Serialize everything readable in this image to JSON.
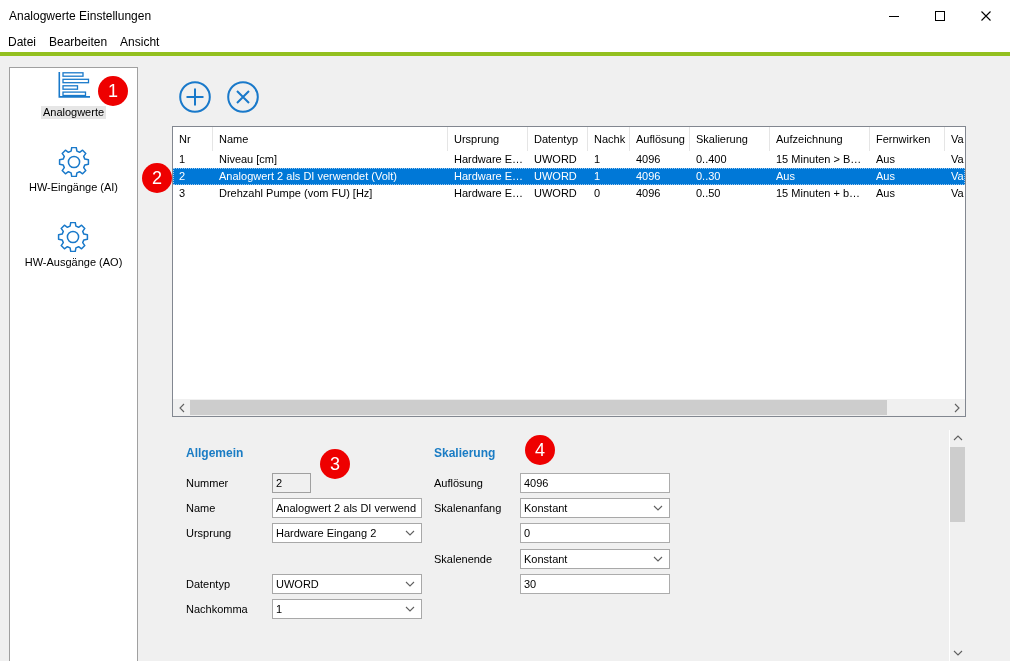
{
  "window": {
    "title": "Analogwerte Einstellungen"
  },
  "menu": [
    {
      "label": "Datei"
    },
    {
      "label": "Bearbeiten"
    },
    {
      "label": "Ansicht"
    }
  ],
  "sidebar": {
    "items": [
      {
        "label": "Analogwerte",
        "kind": "bars",
        "selected": true
      },
      {
        "label": "HW-Eingänge (AI)",
        "kind": "gear",
        "selected": false
      },
      {
        "label": "HW-Ausgänge (AO)",
        "kind": "gear",
        "selected": false
      }
    ]
  },
  "toolbar": [
    {
      "kind": "add"
    },
    {
      "kind": "remove"
    }
  ],
  "table": {
    "columns": [
      "Nr",
      "Name",
      "Ursprung",
      "Datentyp",
      "Nachk",
      "Auflösung",
      "Skalierung",
      "Aufzeichnung",
      "Fernwirken",
      "Va"
    ],
    "rows": [
      {
        "selected": false,
        "cells": [
          "1",
          "Niveau [cm]",
          "Hardware E…",
          "UWORD",
          "1",
          "4096",
          "0..400",
          "15 Minuten > B…",
          "Aus",
          "Va"
        ]
      },
      {
        "selected": true,
        "cells": [
          "2",
          "Analogwert 2 als DI verwendet (Volt)",
          "Hardware E…",
          "UWORD",
          "1",
          "4096",
          "0..30",
          "Aus",
          "Aus",
          "Va"
        ]
      },
      {
        "selected": false,
        "cells": [
          "3",
          "Drehzahl Pumpe (vom FU) [Hz]",
          "Hardware E…",
          "UWORD",
          "0",
          "4096",
          "0..50",
          "15 Minuten + b…",
          "Aus",
          "Va"
        ]
      }
    ]
  },
  "details": {
    "sections": [
      {
        "title": "Allgemein",
        "rows": [
          {
            "label": "Nummer",
            "kind": "readonly",
            "value": "2"
          },
          {
            "label": "Name",
            "kind": "text",
            "value": "Analogwert 2 als DI verwend"
          },
          {
            "label": "Ursprung",
            "kind": "select",
            "value": "Hardware Eingang 2"
          },
          {
            "kind": "blank"
          },
          {
            "label": "Datentyp",
            "kind": "select",
            "value": "UWORD"
          },
          {
            "label": "Nachkomma",
            "kind": "select",
            "value": "1"
          }
        ]
      },
      {
        "title": "Skalierung",
        "rows": [
          {
            "label": "Auflösung",
            "kind": "text",
            "value": "4096"
          },
          {
            "label": "Skalenanfang",
            "kind": "select",
            "value": "Konstant"
          },
          {
            "kind": "text",
            "value": "0"
          },
          {
            "label": "Skalenende",
            "kind": "select",
            "value": "Konstant"
          },
          {
            "kind": "text",
            "value": "30"
          }
        ]
      }
    ]
  },
  "callouts": [
    "1",
    "2",
    "3",
    "4"
  ]
}
